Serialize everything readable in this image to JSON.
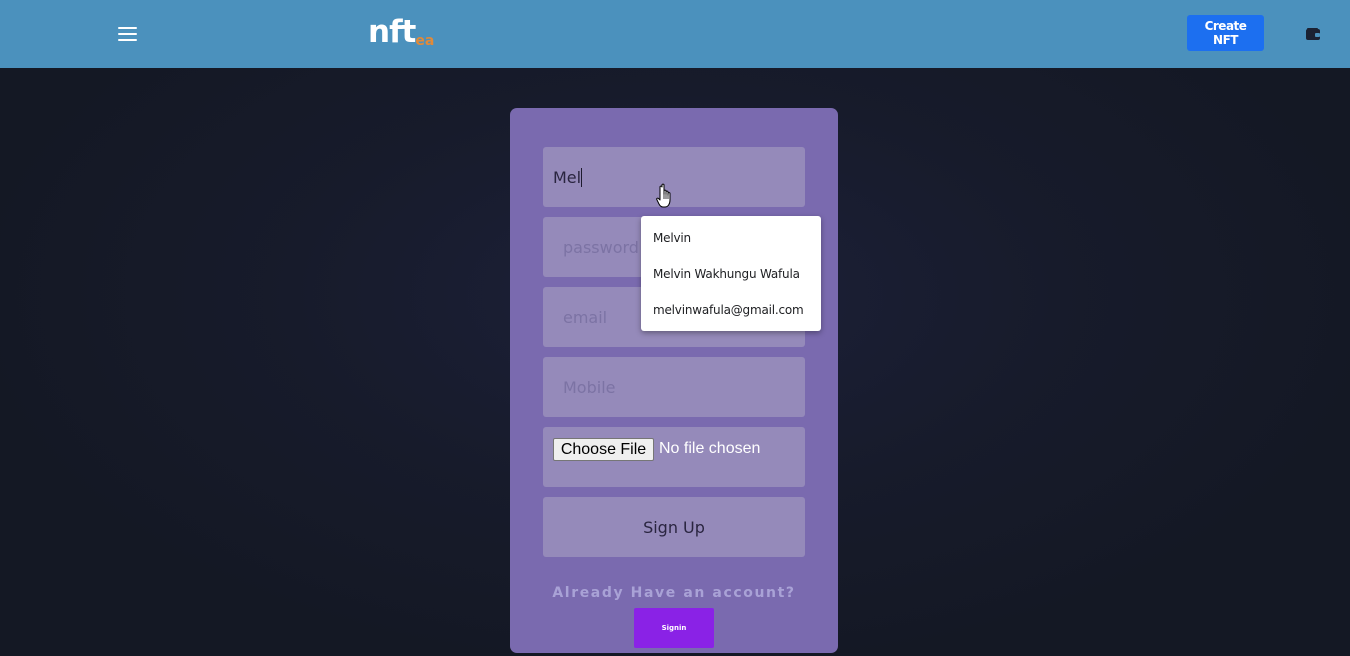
{
  "navbar": {
    "logo_main": "nft",
    "logo_sub": "ea",
    "create_button": "Create NFT",
    "menu_icon": "hamburger-menu-icon",
    "wallet_icon": "wallet-icon",
    "background": "#4b91bd",
    "button_color": "#1c6ff0"
  },
  "form": {
    "username_value": "Mel",
    "password_placeholder": "password",
    "email_placeholder": "email",
    "mobile_placeholder": "Mobile",
    "file_button": "Choose File",
    "file_status": "No file chosen",
    "signup_button": "Sign Up",
    "have_account_text": "Already Have an account?",
    "signin_button": "Signin",
    "card_color": "#7a6aaf",
    "field_color": "#958aba",
    "signin_color": "#8a22e6"
  },
  "autocomplete": {
    "items": [
      "Melvin",
      "Melvin Wakhungu Wafula",
      "melvinwafula@gmail.com"
    ]
  }
}
